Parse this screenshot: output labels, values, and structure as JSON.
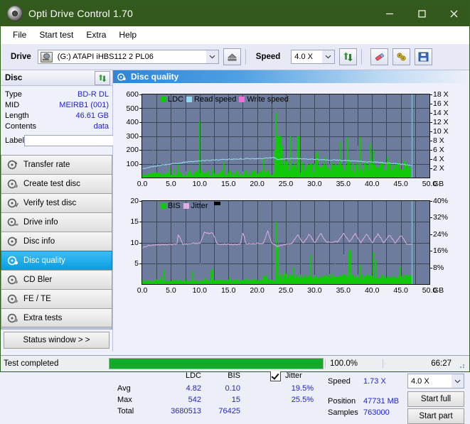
{
  "window": {
    "title": "Opti Drive Control 1.70",
    "app_icon": "disc-icon",
    "minimize": "−",
    "maximize": "□",
    "close": "×"
  },
  "menu": {
    "items": [
      "File",
      "Start test",
      "Extra",
      "Help"
    ]
  },
  "toolbar": {
    "drive_label": "Drive",
    "drive_value": "(G:)  ATAPI iHBS112  2 PL06",
    "eject_icon": "eject-icon",
    "speed_label": "Speed",
    "speed_value": "4.0 X",
    "refresh_icon": "refresh-icon",
    "erase_icon": "eraser-icon",
    "tools_icon": "tools-icon",
    "save_icon": "save-icon"
  },
  "disc_panel": {
    "header": "Disc",
    "refresh_icon": "refresh-icon",
    "rows": [
      {
        "key": "Type",
        "value": "BD-R DL"
      },
      {
        "key": "MID",
        "value": "MEIRB1 (001)"
      },
      {
        "key": "Length",
        "value": "46.61 GB"
      },
      {
        "key": "Contents",
        "value": "data"
      }
    ],
    "label_key": "Label",
    "label_value": "",
    "label_placeholder": "",
    "disc_button_icon": "disc-icon"
  },
  "nav": {
    "items": [
      {
        "label": "Transfer rate",
        "icon": "disc-rate-icon",
        "selected": false
      },
      {
        "label": "Create test disc",
        "icon": "disc-create-icon",
        "selected": false
      },
      {
        "label": "Verify test disc",
        "icon": "disc-verify-icon",
        "selected": false
      },
      {
        "label": "Drive info",
        "icon": "disc-drive-icon",
        "selected": false
      },
      {
        "label": "Disc info",
        "icon": "disc-info-icon",
        "selected": false
      },
      {
        "label": "Disc quality",
        "icon": "disc-quality-icon",
        "selected": true
      },
      {
        "label": "CD Bler",
        "icon": "disc-bler-icon",
        "selected": false
      },
      {
        "label": "FE / TE",
        "icon": "disc-fete-icon",
        "selected": false
      },
      {
        "label": "Extra tests",
        "icon": "disc-extra-icon",
        "selected": false
      }
    ],
    "status_window": "Status window > >"
  },
  "content": {
    "header_title": "Disc quality",
    "header_icon": "disc-quality-icon"
  },
  "stats": {
    "col_headers": [
      "LDC",
      "BIS"
    ],
    "jitter_label": "Jitter",
    "jitter_checked": true,
    "rows": [
      {
        "name": "Avg",
        "ldc": "4.82",
        "bis": "0.10",
        "jitter": "19.5%"
      },
      {
        "name": "Max",
        "ldc": "542",
        "bis": "15",
        "jitter": "25.5%"
      },
      {
        "name": "Total",
        "ldc": "3680513",
        "bis": "76425",
        "jitter": ""
      }
    ],
    "speed_label": "Speed",
    "speed_value": "1.73 X",
    "position_label": "Position",
    "position_value": "47731 MB",
    "samples_label": "Samples",
    "samples_value": "763000",
    "speed_select": "4.0 X",
    "start_full": "Start full",
    "start_part": "Start part"
  },
  "statusbar": {
    "text": "Test completed",
    "progress_pct": 100.0,
    "progress_label": "100.0%",
    "elapsed": "66:27"
  },
  "colors": {
    "titlebar": "#33591c",
    "ldc_green": "#12c80a",
    "read_speed": "#96d8f0",
    "write_speed": "#f070d8",
    "jitter_pink": "#e0aede",
    "plot_bg": "#6d7c9c",
    "grid": "#3d4559",
    "value_blue": "#2323c8",
    "accent_blue": "#2f86d6"
  },
  "chart_data": [
    {
      "type": "line",
      "id": "ldc-chart",
      "title": "",
      "legend": [
        {
          "label": "LDC",
          "color": "#12c80a"
        },
        {
          "label": "Read speed",
          "color": "#96d8f0"
        },
        {
          "label": "Write speed",
          "color": "#f070d8"
        }
      ],
      "legend_position": "top-left",
      "grid": true,
      "xlabel": "GB",
      "xlim": [
        0,
        50
      ],
      "xticks": [
        "0.0",
        "5.0",
        "10.0",
        "15.0",
        "20.0",
        "25.0",
        "30.0",
        "35.0",
        "40.0",
        "45.0",
        "50.0"
      ],
      "ylabel_left": "",
      "ylim": [
        0,
        600
      ],
      "yticks_left": [
        "100",
        "200",
        "300",
        "400",
        "500",
        "600"
      ],
      "ylabel_right": "X",
      "ylim_right": [
        0,
        18
      ],
      "yticks_right": [
        "2 X",
        "4 X",
        "6 X",
        "8 X",
        "10 X",
        "12 X",
        "14 X",
        "16 X",
        "18 X"
      ],
      "series": [
        {
          "name": "LDC",
          "color": "#12c80a",
          "kind": "impulse",
          "x": [
            0.0,
            0.3,
            0.6,
            0.9,
            1.2,
            1.5,
            1.8,
            2.1,
            2.4,
            2.6,
            2.8,
            3.0,
            3.3,
            3.6,
            3.9,
            4.2,
            4.5,
            4.8,
            5.1,
            5.4,
            5.5,
            5.8,
            6.1,
            6.4,
            6.7,
            7.0,
            7.3,
            7.6,
            7.9,
            8.2,
            8.5,
            8.8,
            9.1,
            9.4,
            9.7,
            9.9,
            10.1,
            10.3,
            10.5,
            10.8,
            11.1,
            11.4,
            11.7,
            12.0,
            12.1,
            12.4,
            12.7,
            13.0,
            13.3,
            13.6,
            13.9,
            14.2,
            14.5,
            14.8,
            15.1,
            15.4,
            15.7,
            16.0,
            16.3,
            16.6,
            16.9,
            17.2,
            17.5,
            17.8,
            18.1,
            18.4,
            18.7,
            19.0,
            19.3,
            19.6,
            19.9,
            20.2,
            20.5,
            20.8,
            21.1,
            21.4,
            21.5,
            21.8,
            22.1,
            22.4,
            22.7,
            23.0,
            23.1,
            23.2,
            23.3,
            23.4,
            23.5,
            23.6,
            23.8,
            24.0,
            24.2,
            24.4,
            24.6,
            24.8,
            25.0,
            25.3,
            25.6,
            25.9,
            26.2,
            26.5,
            26.8,
            27.1,
            27.4,
            27.7,
            28.0,
            28.3,
            28.6,
            28.9,
            29.2,
            29.5,
            29.8,
            30.1,
            30.4,
            30.8,
            31.1,
            31.4,
            31.7,
            32.0,
            32.3,
            32.6,
            32.9,
            33.2,
            33.5,
            33.8,
            34.1,
            34.4,
            34.7,
            35.0,
            35.3,
            35.6,
            35.9,
            36.2,
            36.5,
            36.8,
            37.1,
            37.4,
            37.7,
            38.0,
            38.3,
            38.6,
            38.9,
            39.2,
            39.5,
            39.8,
            40.1,
            40.4,
            40.7,
            41.0,
            41.3,
            41.6,
            41.9,
            42.2,
            42.5,
            42.8,
            43.1,
            43.4,
            43.7,
            44.0,
            44.3,
            44.6,
            44.9,
            45.2,
            45.5,
            45.8,
            46.1,
            46.4,
            46.7,
            46.9
          ],
          "y": [
            20,
            25,
            18,
            22,
            30,
            28,
            250,
            60,
            40,
            175,
            45,
            35,
            30,
            55,
            25,
            40,
            30,
            235,
            50,
            35,
            60,
            45,
            30,
            40,
            35,
            55,
            30,
            45,
            40,
            60,
            50,
            70,
            45,
            40,
            60,
            410,
            60,
            185,
            80,
            55,
            45,
            50,
            60,
            300,
            70,
            50,
            55,
            80,
            60,
            45,
            50,
            40,
            55,
            45,
            60,
            40,
            50,
            45,
            55,
            40,
            50,
            60,
            45,
            50,
            55,
            45,
            60,
            50,
            45,
            55,
            50,
            60,
            50,
            45,
            140,
            70,
            50,
            60,
            55,
            75,
            90,
            200,
            545,
            300,
            470,
            260,
            300,
            310,
            300,
            305,
            230,
            180,
            150,
            130,
            120,
            110,
            100,
            120,
            90,
            110,
            95,
            100,
            105,
            115,
            95,
            100,
            110,
            90,
            100,
            105,
            95,
            110,
            190,
            120,
            100,
            95,
            150,
            110,
            130,
            100,
            115,
            95,
            120,
            100,
            110,
            260,
            95,
            105,
            120,
            290,
            130,
            110,
            100,
            120,
            105,
            95,
            115,
            100,
            110,
            105,
            120,
            95,
            100,
            110,
            200,
            95,
            105,
            120,
            100,
            110,
            95,
            115,
            100,
            105,
            110,
            95,
            120,
            100,
            110,
            105,
            115,
            100,
            125,
            110,
            95,
            120
          ]
        },
        {
          "name": "Read speed",
          "color": "#96d8f0",
          "kind": "line",
          "x": [
            0.0,
            2.0,
            4.0,
            6.0,
            8.0,
            10.0,
            12.0,
            14.0,
            16.0,
            18.0,
            20.0,
            22.0,
            23.0,
            23.3,
            25.0,
            27.0,
            29.0,
            31.0,
            33.0,
            35.0,
            37.0,
            39.0,
            41.0,
            43.0,
            45.0,
            46.5,
            46.9
          ],
          "y_right": [
            1.9,
            2.4,
            2.8,
            3.1,
            3.4,
            3.6,
            3.8,
            3.9,
            4.0,
            4.1,
            4.1,
            4.2,
            4.3,
            3.9,
            4.1,
            4.1,
            4.0,
            3.9,
            3.8,
            3.7,
            3.6,
            3.4,
            3.3,
            3.1,
            2.9,
            2.7,
            2.6
          ]
        },
        {
          "name": "Write speed",
          "color": "#f070d8",
          "kind": "line",
          "x": [],
          "y": []
        }
      ],
      "cursor_line": {
        "x": 46.9,
        "color": "#55c8f0"
      }
    },
    {
      "type": "line",
      "id": "bis-jitter-chart",
      "title": "",
      "legend": [
        {
          "label": "BIS",
          "color": "#12c80a"
        },
        {
          "label": "Jitter",
          "color": "#e0aede"
        }
      ],
      "legend_position": "top-left",
      "grid": true,
      "xlabel": "GB",
      "xlim": [
        0,
        50
      ],
      "xticks": [
        "0.0",
        "5.0",
        "10.0",
        "15.0",
        "20.0",
        "25.0",
        "30.0",
        "35.0",
        "40.0",
        "45.0",
        "50.0"
      ],
      "ylim": [
        0,
        20
      ],
      "yticks_left": [
        "5",
        "10",
        "15",
        "20"
      ],
      "ylim_right": [
        0,
        40
      ],
      "yticks_right": [
        "8%",
        "16%",
        "24%",
        "32%",
        "40%"
      ],
      "series": [
        {
          "name": "BIS",
          "color": "#12c80a",
          "kind": "impulse",
          "x": [
            0.0,
            0.5,
            1.0,
            1.5,
            2.0,
            2.3,
            2.6,
            2.9,
            3.2,
            3.5,
            3.8,
            4.1,
            4.4,
            4.7,
            5.0,
            5.3,
            5.6,
            5.9,
            6.2,
            6.5,
            6.8,
            7.1,
            7.4,
            7.7,
            8.0,
            8.3,
            8.6,
            8.9,
            9.2,
            9.5,
            9.8,
            10.0,
            10.3,
            10.6,
            10.9,
            11.2,
            11.5,
            11.8,
            12.1,
            12.4,
            12.7,
            13.0,
            13.3,
            13.6,
            13.9,
            14.2,
            14.5,
            14.8,
            15.1,
            15.4,
            15.7,
            16.0,
            16.3,
            16.6,
            16.9,
            17.2,
            17.5,
            17.8,
            18.1,
            18.4,
            18.7,
            19.0,
            19.3,
            19.6,
            19.9,
            20.2,
            20.5,
            20.8,
            21.1,
            21.4,
            21.7,
            22.0,
            22.3,
            22.6,
            22.9,
            23.1,
            23.3,
            23.5,
            23.7,
            23.9,
            24.1,
            24.4,
            24.7,
            25.0,
            25.4,
            25.8,
            26.2,
            26.6,
            27.0,
            27.4,
            27.8,
            28.2,
            28.6,
            29.0,
            29.4,
            29.8,
            30.2,
            30.6,
            31.0,
            31.4,
            31.8,
            32.2,
            32.6,
            33.0,
            33.4,
            33.8,
            34.2,
            34.6,
            35.0,
            35.4,
            35.8,
            36.2,
            36.6,
            37.0,
            37.4,
            37.8,
            38.2,
            38.6,
            39.0,
            39.4,
            39.8,
            40.2,
            40.6,
            41.0,
            41.4,
            41.8,
            42.2,
            42.6,
            43.0,
            43.4,
            43.8,
            44.2,
            44.6,
            45.0,
            45.4,
            45.8,
            46.2,
            46.6,
            46.9
          ],
          "y": [
            1.0,
            0.7,
            0.8,
            0.7,
            0.9,
            5.0,
            1.5,
            0.9,
            1.8,
            0.8,
            0.9,
            0.7,
            0.8,
            0.9,
            0.7,
            1.0,
            4.8,
            0.9,
            0.8,
            1.0,
            0.9,
            0.8,
            1.2,
            0.9,
            1.0,
            0.9,
            1.1,
            0.8,
            1.0,
            0.9,
            1.0,
            5.1,
            1.0,
            0.9,
            1.5,
            1.0,
            0.9,
            1.0,
            3.8,
            1.0,
            0.9,
            1.0,
            0.9,
            1.0,
            0.9,
            1.0,
            0.9,
            1.0,
            1.8,
            1.0,
            0.9,
            1.0,
            1.2,
            1.0,
            0.9,
            1.0,
            0.9,
            1.0,
            1.5,
            1.0,
            0.9,
            1.0,
            1.3,
            1.0,
            0.9,
            1.0,
            1.1,
            1.0,
            2.0,
            1.0,
            0.9,
            1.0,
            1.2,
            1.0,
            1.5,
            6.0,
            15.0,
            9.0,
            11.0,
            5.5,
            4.5,
            3.5,
            3.0,
            2.5,
            3.5,
            2.0,
            4.0,
            2.2,
            1.8,
            2.6,
            1.9,
            2.2,
            1.8,
            2.0,
            1.7,
            2.1,
            1.8,
            4.2,
            2.0,
            1.9,
            2.2,
            1.8,
            2.4,
            2.0,
            1.9,
            2.1,
            1.8,
            2.0,
            7.2,
            2.0,
            1.9,
            8.3,
            2.2,
            1.8,
            2.0,
            2.1,
            1.9,
            2.0,
            2.2,
            1.8,
            2.0,
            2.1,
            5.8,
            2.0,
            1.9,
            2.1,
            1.8,
            2.0,
            2.2,
            1.9,
            2.0,
            4.6,
            2.1,
            1.9,
            2.0,
            2.2,
            1.8,
            4.8,
            2.0
          ]
        },
        {
          "name": "Jitter",
          "color": "#e0aede",
          "kind": "line",
          "x": [
            0.0,
            1.0,
            2.0,
            3.0,
            4.0,
            5.0,
            6.0,
            6.2,
            7.0,
            8.0,
            9.0,
            10.0,
            10.8,
            11.5,
            12.2,
            13.0,
            14.0,
            15.0,
            16.0,
            17.0,
            17.5,
            18.0,
            19.0,
            20.0,
            21.0,
            21.8,
            22.5,
            23.0,
            23.3,
            24.0,
            25.0,
            26.0,
            27.0,
            28.0,
            29.0,
            30.0,
            31.0,
            32.0,
            33.0,
            34.0,
            35.0,
            36.0,
            37.0,
            38.0,
            39.0,
            40.0,
            41.0,
            42.0,
            43.0,
            44.0,
            45.0,
            46.0,
            46.9
          ],
          "y_right": [
            17.6,
            18.4,
            18.8,
            19.0,
            19.0,
            19.0,
            19.4,
            24.0,
            19.2,
            19.4,
            19.6,
            19.6,
            25.0,
            24.4,
            24.8,
            19.4,
            19.2,
            19.2,
            19.0,
            19.2,
            25.0,
            19.4,
            19.4,
            19.6,
            19.6,
            25.5,
            19.4,
            19.0,
            18.2,
            18.6,
            19.2,
            19.6,
            23.8,
            19.6,
            24.0,
            19.8,
            24.5,
            20.0,
            20.2,
            20.4,
            24.6,
            20.2,
            24.2,
            20.0,
            24.0,
            20.0,
            24.2,
            19.8,
            23.8,
            19.6,
            23.6,
            19.2,
            19.0
          ]
        }
      ],
      "cursor_line": {
        "x": 46.9,
        "color": "#55c8f0"
      }
    }
  ]
}
